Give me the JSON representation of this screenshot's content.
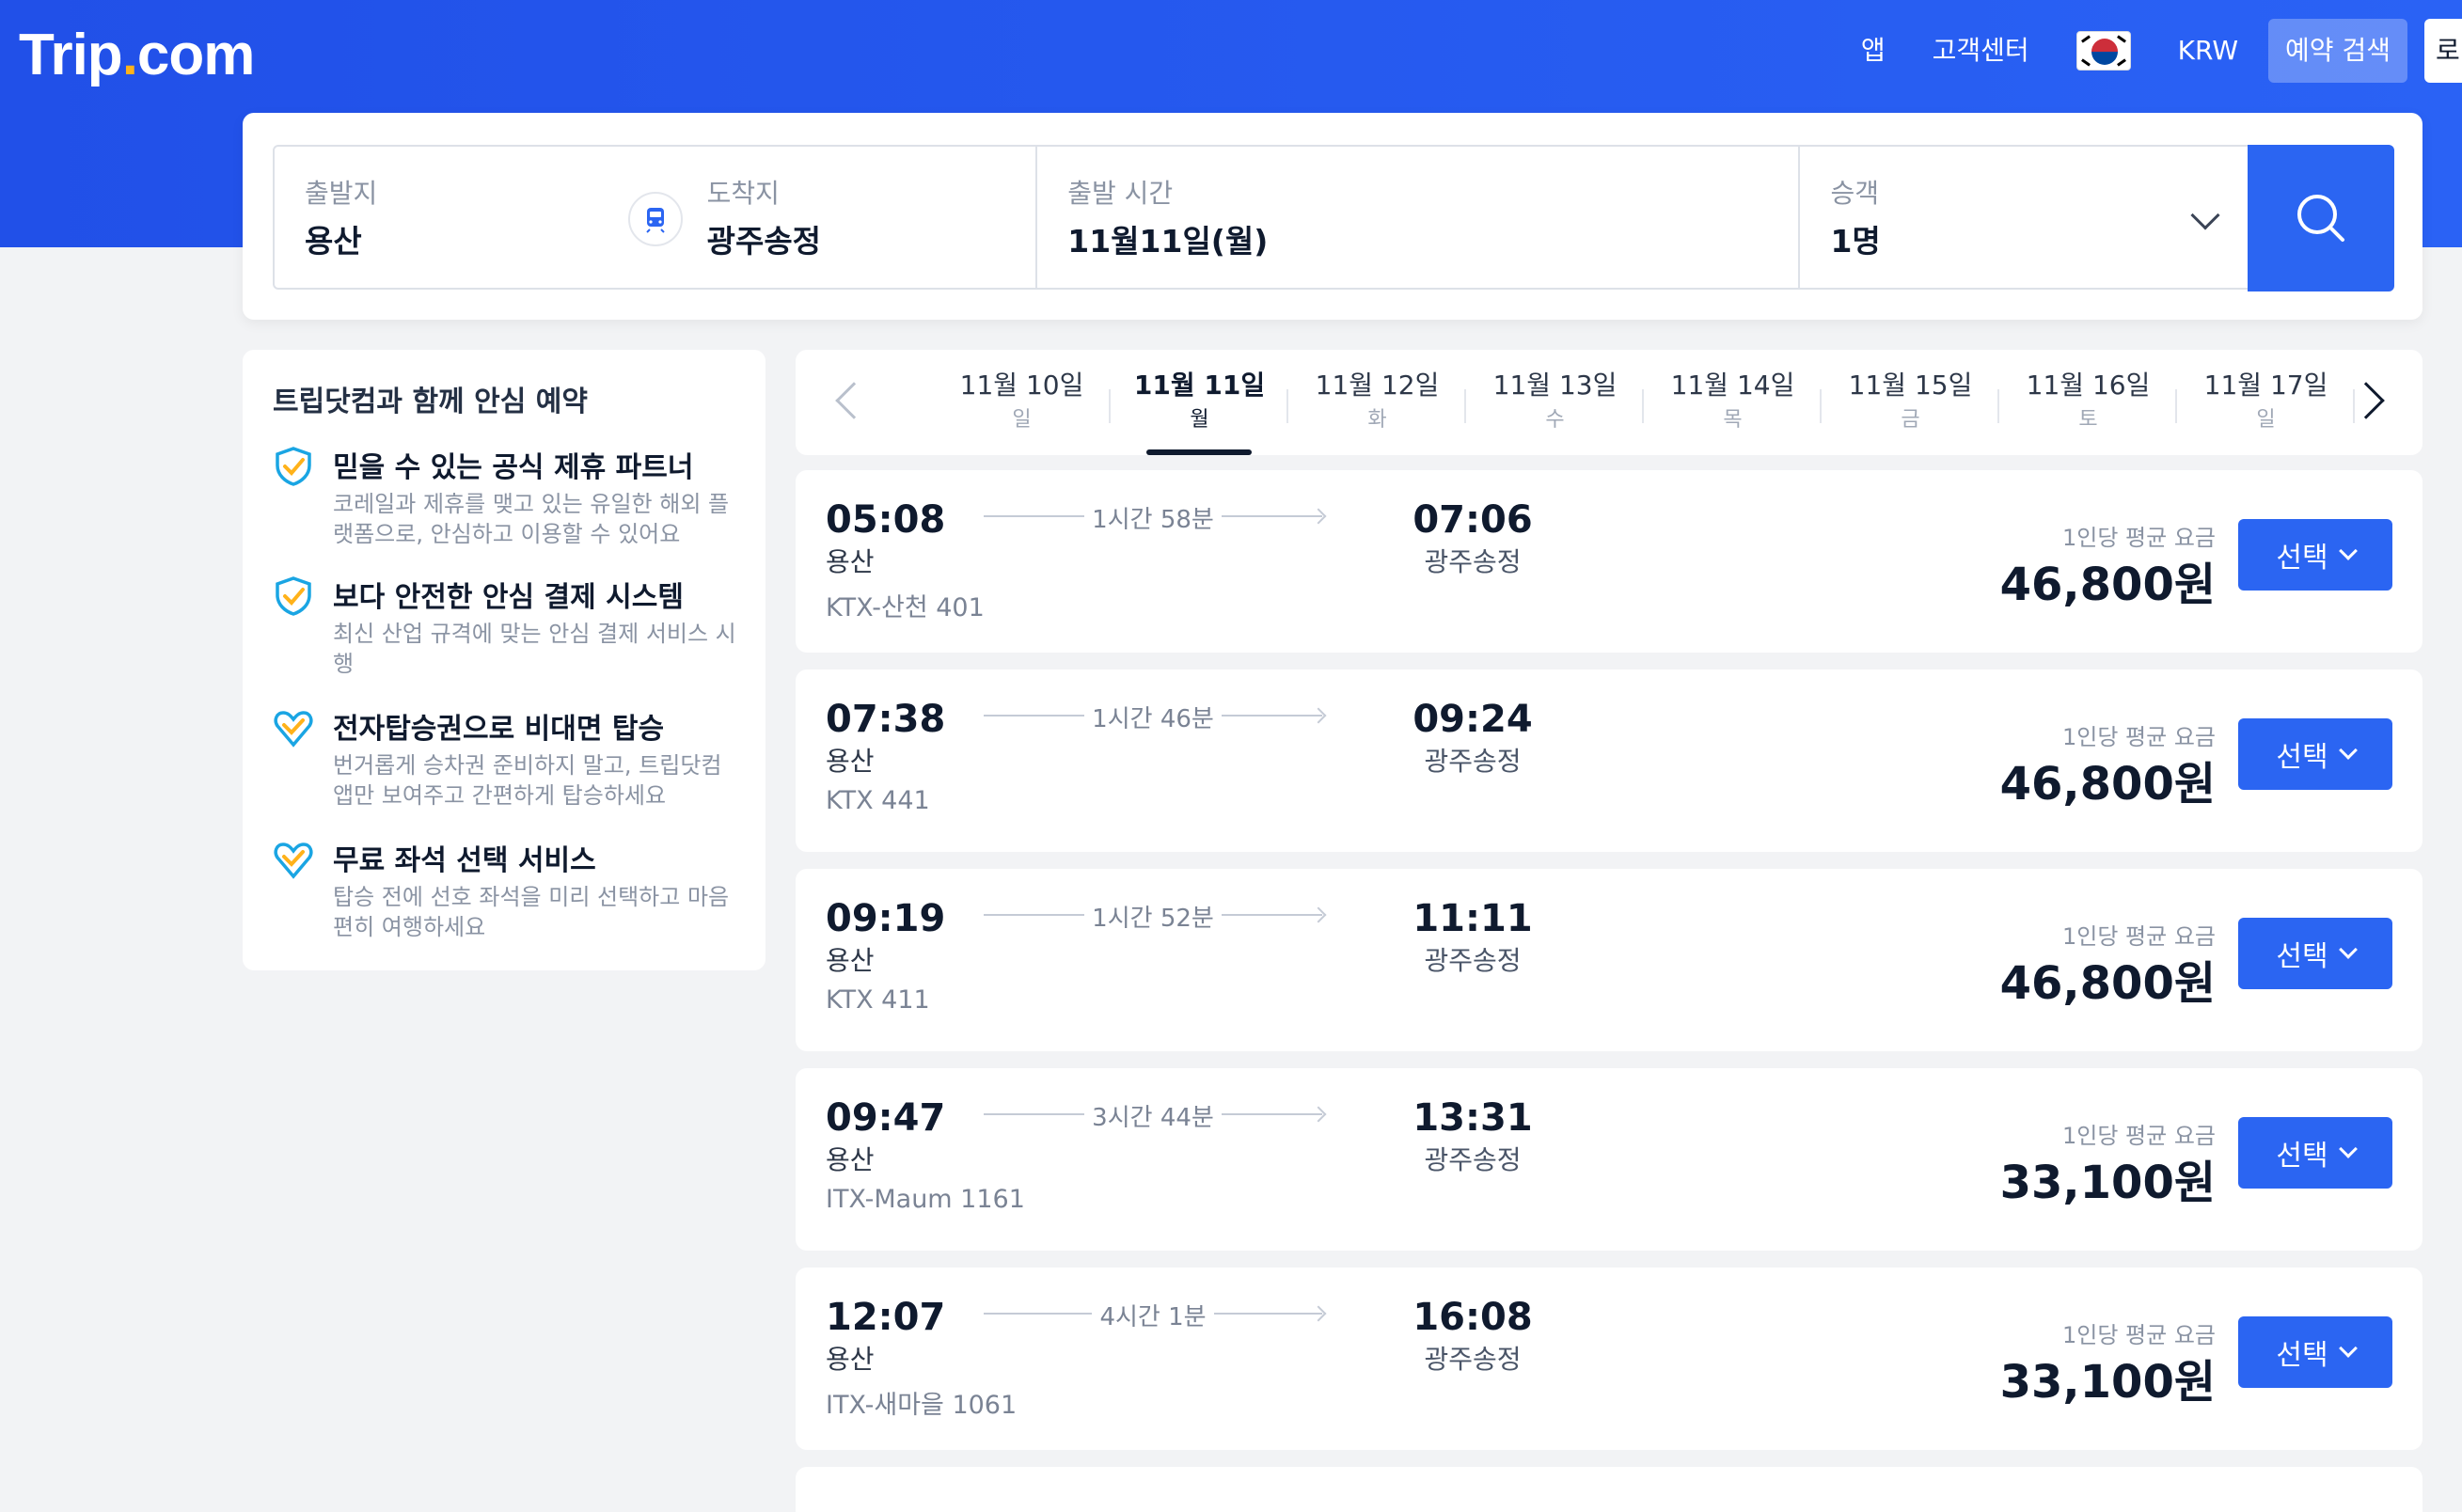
{
  "header": {
    "logo_main": "Trip",
    "logo_dot": ".",
    "logo_tail": "com",
    "nav": [
      "앱",
      "고객센터"
    ],
    "currency": "KRW",
    "reserve_label": "예약 검색",
    "login_label": "로그인",
    "flag_icon": "south-korea-flag-icon"
  },
  "search": {
    "from_label": "출발지",
    "from_value": "용산",
    "to_label": "도착지",
    "to_value": "광주송정",
    "time_label": "출발 시간",
    "time_value": "11월11일(월)",
    "pax_label": "승객",
    "pax_value": "1명"
  },
  "sidebar": {
    "title": "트립닷컴과 함께 안심 예약",
    "features": [
      {
        "title": "믿을 수 있는 공식 제휴 파트너",
        "desc": "코레일과 제휴를 맺고 있는 유일한 해외 플랫폼으로, 안심하고 이용할 수 있어요",
        "icon": "shield-check-icon"
      },
      {
        "title": "보다 안전한 안심 결제 시스템",
        "desc": "최신 산업 규격에 맞는 안심 결제 서비스 시행",
        "icon": "shield-check-icon"
      },
      {
        "title": "전자탑승권으로 비대면 탑승",
        "desc": "번거롭게 승차권 준비하지 말고, 트립닷컴 앱만 보여주고 간편하게 탑승하세요",
        "icon": "heart-check-icon"
      },
      {
        "title": "무료 좌석 선택 서비스",
        "desc": "탑승 전에 선호 좌석을 미리 선택하고 마음 편히 여행하세요",
        "icon": "heart-check-icon"
      }
    ]
  },
  "dates": [
    {
      "md": "11월 10일",
      "dow": "일"
    },
    {
      "md": "11월 11일",
      "dow": "월"
    },
    {
      "md": "11월 12일",
      "dow": "화"
    },
    {
      "md": "11월 13일",
      "dow": "수"
    },
    {
      "md": "11월 14일",
      "dow": "목"
    },
    {
      "md": "11월 15일",
      "dow": "금"
    },
    {
      "md": "11월 16일",
      "dow": "토"
    },
    {
      "md": "11월 17일",
      "dow": "일"
    }
  ],
  "active_date": "11월 11일",
  "trains": [
    {
      "dep": "05:08",
      "dep_station": "용산",
      "train_no": "KTX-산천 401",
      "duration": "1시간 58분",
      "arr": "07:06",
      "arr_station": "광주송정",
      "price_label": "1인당 평균 요금",
      "price": "46,800원",
      "select_label": "선택"
    },
    {
      "dep": "07:38",
      "dep_station": "용산",
      "train_no": "KTX 441",
      "duration": "1시간 46분",
      "arr": "09:24",
      "arr_station": "광주송정",
      "price_label": "1인당 평균 요금",
      "price": "46,800원",
      "select_label": "선택"
    },
    {
      "dep": "09:19",
      "dep_station": "용산",
      "train_no": "KTX 411",
      "duration": "1시간 52분",
      "arr": "11:11",
      "arr_station": "광주송정",
      "price_label": "1인당 평균 요금",
      "price": "46,800원",
      "select_label": "선택"
    },
    {
      "dep": "09:47",
      "dep_station": "용산",
      "train_no": "ITX-Maum 1161",
      "duration": "3시간 44분",
      "arr": "13:31",
      "arr_station": "광주송정",
      "price_label": "1인당 평균 요금",
      "price": "33,100원",
      "select_label": "선택"
    },
    {
      "dep": "12:07",
      "dep_station": "용산",
      "train_no": "ITX-새마을 1061",
      "duration": "4시간 1분",
      "arr": "16:08",
      "arr_station": "광주송정",
      "price_label": "1인당 평균 요금",
      "price": "33,100원",
      "select_label": "선택"
    }
  ],
  "colors": {
    "brand": "#2150e8",
    "button": "#2b65f2",
    "logo_dot": "#ffb21a"
  }
}
